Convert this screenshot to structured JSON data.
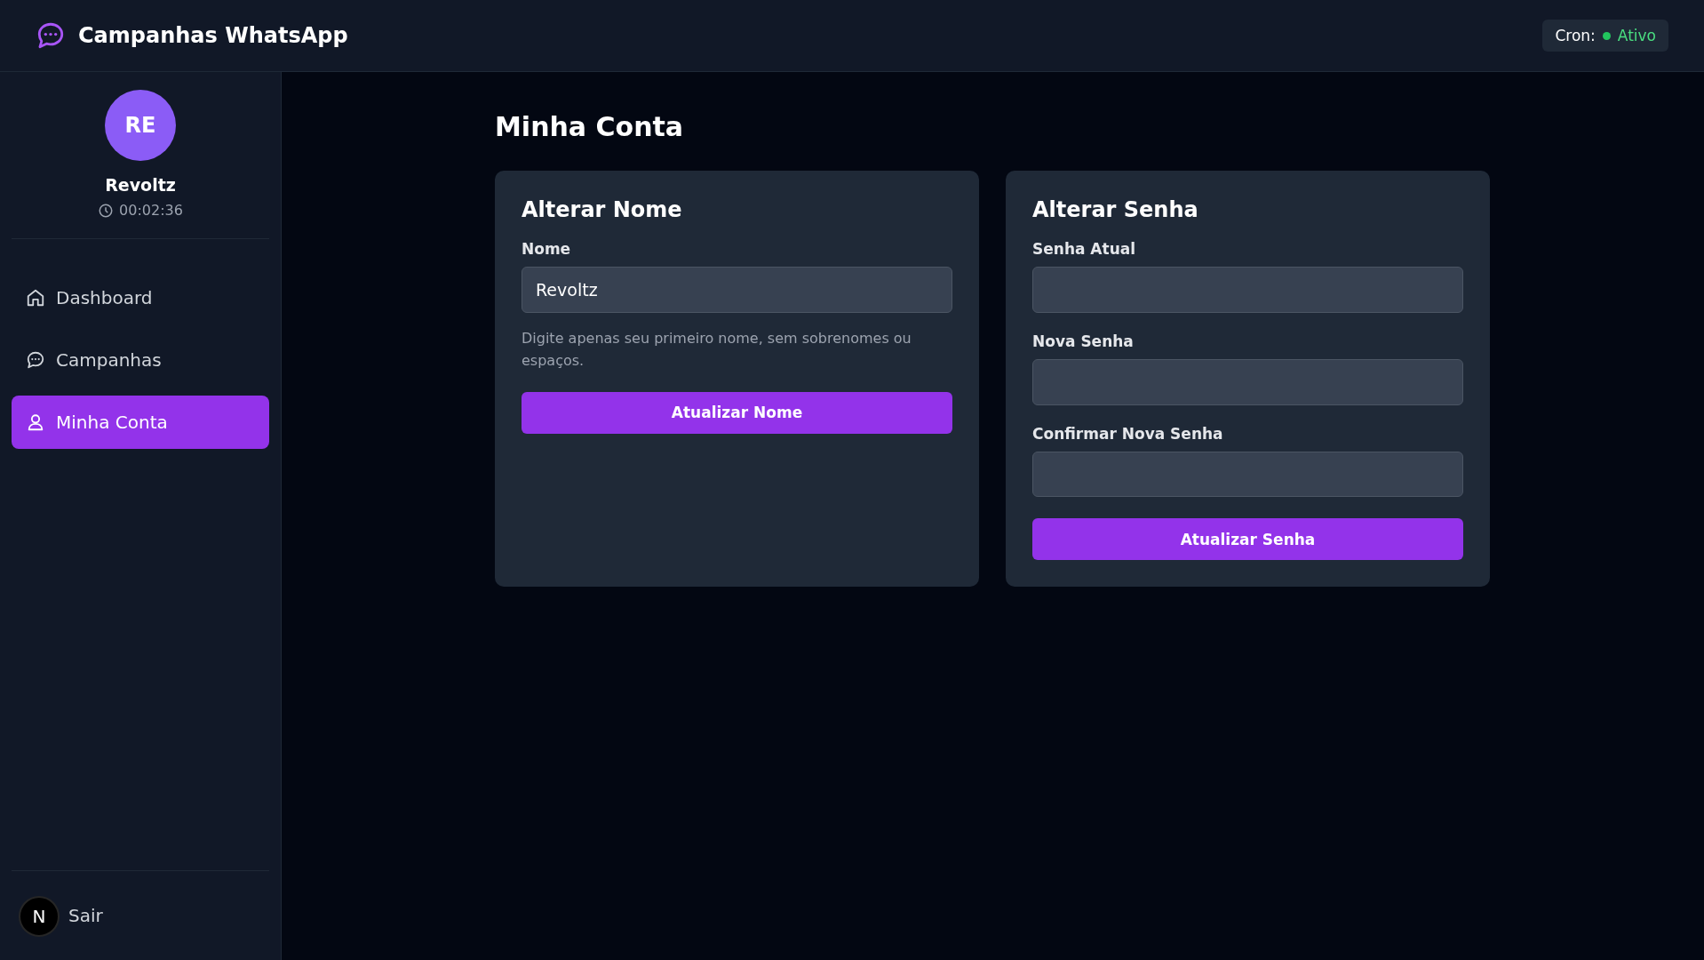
{
  "header": {
    "title": "Campanhas WhatsApp",
    "cron": {
      "label": "Cron:",
      "status": "Ativo",
      "on": true
    }
  },
  "sidebar": {
    "user": {
      "initials": "RE",
      "name": "Revoltz",
      "session_time": "00:02:36"
    },
    "items": [
      {
        "label": "Dashboard",
        "kind": "home",
        "selected": false
      },
      {
        "label": "Campanhas",
        "kind": "chat",
        "selected": false
      },
      {
        "label": "Minha Conta",
        "kind": "user",
        "selected": true
      }
    ],
    "logout": "Sair",
    "dev_badge": "N"
  },
  "page": {
    "title": "Minha Conta",
    "cards": [
      {
        "title": "Alterar Nome",
        "fields": [
          {
            "label": "Nome",
            "value": "Revoltz",
            "hint": "Digite apenas seu primeiro nome, sem sobrenomes ou espaços."
          }
        ],
        "button": "Atualizar Nome"
      },
      {
        "title": "Alterar Senha",
        "fields": [
          {
            "label": "Senha Atual"
          },
          {
            "label": "Nova Senha"
          },
          {
            "label": "Confirmar Nova Senha"
          }
        ],
        "button": "Atualizar Senha"
      }
    ]
  }
}
